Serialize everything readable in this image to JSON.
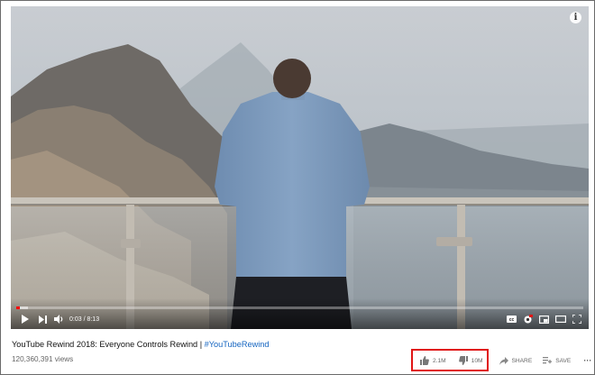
{
  "video": {
    "current_time": "0:03",
    "duration": "8:13",
    "time_separator": " / ",
    "progress_fraction": 0.006,
    "buffered_fraction": 0.02,
    "info_glyph": "i",
    "icons": [
      "play-icon",
      "next-icon",
      "volume-icon",
      "subtitles-icon",
      "settings-icon",
      "miniplayer-icon",
      "theater-icon",
      "fullscreen-icon"
    ]
  },
  "meta": {
    "title": "YouTube Rewind 2018: Everyone Controls Rewind | ",
    "hashtag": "#YouTubeRewind",
    "views": "120,360,391 views"
  },
  "actions": {
    "likes": "2.1M",
    "dislikes": "10M",
    "share": "SHARE",
    "save": "SAVE",
    "more": "···"
  },
  "colors": {
    "progress": "#ff0000",
    "highlight_box": "#e01515",
    "hashtag": "#1565c0"
  }
}
